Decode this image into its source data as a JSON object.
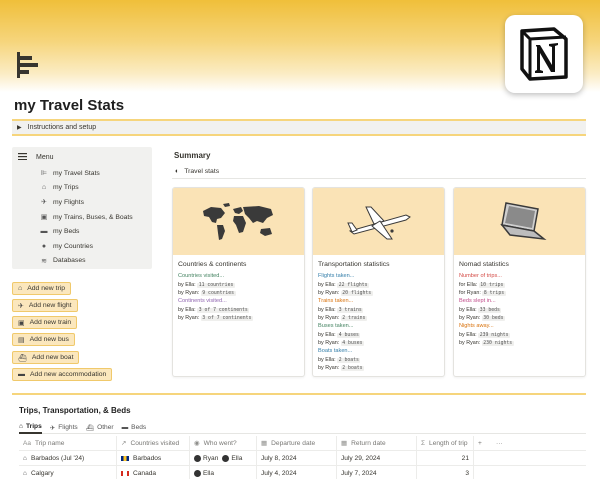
{
  "page": {
    "title": "my Travel Stats",
    "toggle": "Instructions and setup"
  },
  "menu": {
    "title": "Menu",
    "items": [
      {
        "label": "my Travel Stats",
        "icon": "stats-icon"
      },
      {
        "label": "my Trips",
        "icon": "suitcase-icon"
      },
      {
        "label": "my Flights",
        "icon": "airplane-icon"
      },
      {
        "label": "my Trains, Buses, & Boats",
        "icon": "train-icon"
      },
      {
        "label": "my Beds",
        "icon": "bed-icon"
      },
      {
        "label": "my Countries",
        "icon": "map-pin-icon"
      },
      {
        "label": "Databases",
        "icon": "stack-icon"
      }
    ]
  },
  "add_buttons": [
    {
      "label": "Add new trip",
      "icon": "suitcase-icon"
    },
    {
      "label": "Add new flight",
      "icon": "airplane-icon"
    },
    {
      "label": "Add new train",
      "icon": "train-icon"
    },
    {
      "label": "Add new bus",
      "icon": "bus-icon"
    },
    {
      "label": "Add new boat",
      "icon": "boat-icon"
    },
    {
      "label": "Add new accommodation",
      "icon": "bed-icon"
    }
  ],
  "summary": {
    "title": "Summary",
    "tab": "Travel stats"
  },
  "cards": [
    {
      "title": "Countries & continents",
      "groups": [
        {
          "label": "Countries visited...",
          "color": "#448361",
          "rows": [
            {
              "who": "by Ella:",
              "value": "11 countries"
            },
            {
              "who": "by Ryan:",
              "value": "9 countries"
            }
          ]
        },
        {
          "label": "Continents visited...",
          "color": "#9065b0",
          "rows": [
            {
              "who": "by Ella:",
              "value": "3 of 7 continents"
            },
            {
              "who": "by Ryan:",
              "value": "3 of 7 continents"
            }
          ]
        }
      ]
    },
    {
      "title": "Transportation statistics",
      "groups": [
        {
          "label": "Flights taken...",
          "color": "#337ea9",
          "rows": [
            {
              "who": "by Ella:",
              "value": "22 flights"
            },
            {
              "who": "by Ryan:",
              "value": "20 flights"
            }
          ]
        },
        {
          "label": "Trains taken...",
          "color": "#d9730d",
          "rows": [
            {
              "who": "by Ella:",
              "value": "3 trains"
            },
            {
              "who": "by Ryan:",
              "value": "2 trains"
            }
          ]
        },
        {
          "label": "Buses taken...",
          "color": "#448361",
          "rows": [
            {
              "who": "by Ella:",
              "value": "4 buses"
            },
            {
              "who": "by Ryan:",
              "value": "4 buses"
            }
          ]
        },
        {
          "label": "Boats taken...",
          "color": "#337ea9",
          "rows": [
            {
              "who": "by Ella:",
              "value": "2 boats"
            },
            {
              "who": "by Ryan:",
              "value": "2 boats"
            }
          ]
        }
      ]
    },
    {
      "title": "Nomad statistics",
      "groups": [
        {
          "label": "Number of trips...",
          "color": "#d44c47",
          "rows": [
            {
              "who": "for Ella:",
              "value": "10 trips"
            },
            {
              "who": "for Ryan:",
              "value": "8 trips"
            }
          ]
        },
        {
          "label": "Beds slept in...",
          "color": "#c14c8a",
          "rows": [
            {
              "who": "by Ella:",
              "value": "33 beds"
            },
            {
              "who": "by Ryan:",
              "value": "30 beds"
            }
          ]
        },
        {
          "label": "Nights away...",
          "color": "#d9730d",
          "rows": [
            {
              "who": "by Ella:",
              "value": "239 nights"
            },
            {
              "who": "by Ryan:",
              "value": "230 nights"
            }
          ]
        }
      ]
    }
  ],
  "database": {
    "title": "Trips, Transportation, & Beds",
    "tabs": [
      "Trips",
      "Flights",
      "Other",
      "Beds"
    ],
    "columns": [
      "Trip name",
      "Countries visited",
      "Who went?",
      "Departure date",
      "Return date",
      "Length of trip"
    ],
    "rows": [
      {
        "name": "Barbados (Jul '24)",
        "country": "Barbados",
        "who": [
          "Ryan",
          "Ella"
        ],
        "departure": "July 8, 2024",
        "return": "July 29, 2024",
        "length": "21"
      },
      {
        "name": "Calgary",
        "country": "Canada",
        "who": [
          "Ella"
        ],
        "departure": "July 4, 2024",
        "return": "July 7, 2024",
        "length": "3"
      }
    ]
  },
  "colors": {
    "accent": "#f6d57c",
    "card_image_bg": "#fae3b6",
    "button_bg": "#fbe7bd"
  }
}
